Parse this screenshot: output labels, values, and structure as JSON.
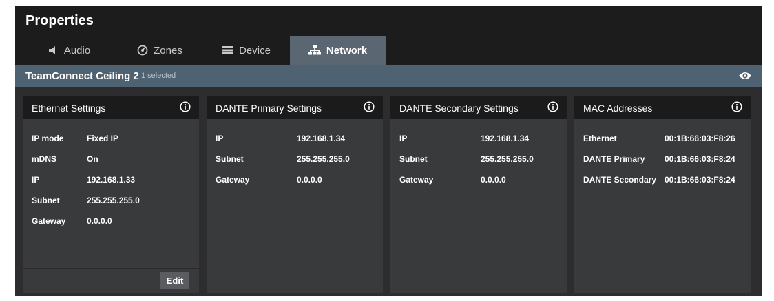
{
  "window": {
    "title": "Properties"
  },
  "tabs": [
    {
      "label": "Audio",
      "icon": "speaker-icon"
    },
    {
      "label": "Zones",
      "icon": "zones-icon"
    },
    {
      "label": "Device",
      "icon": "device-icon"
    },
    {
      "label": "Network",
      "icon": "network-icon",
      "active": true
    }
  ],
  "selection": {
    "device": "TeamConnect Ceiling 2",
    "count": "1 selected",
    "icon": "eye-icon"
  },
  "panels": {
    "ethernet": {
      "title": "Ethernet Settings",
      "rows": [
        {
          "label": "IP mode",
          "value": "Fixed IP"
        },
        {
          "label": "mDNS",
          "value": "On"
        },
        {
          "label": "IP",
          "value": "192.168.1.33"
        },
        {
          "label": "Subnet",
          "value": "255.255.255.0"
        },
        {
          "label": "Gateway",
          "value": "0.0.0.0"
        }
      ],
      "edit_label": "Edit"
    },
    "dante_primary": {
      "title": "DANTE Primary Settings",
      "rows": [
        {
          "label": "IP",
          "value": "192.168.1.34"
        },
        {
          "label": "Subnet",
          "value": "255.255.255.0"
        },
        {
          "label": "Gateway",
          "value": "0.0.0.0"
        }
      ]
    },
    "dante_secondary": {
      "title": "DANTE Secondary Settings",
      "rows": [
        {
          "label": "IP",
          "value": "192.168.1.34"
        },
        {
          "label": "Subnet",
          "value": "255.255.255.0"
        },
        {
          "label": "Gateway",
          "value": "0.0.0.0"
        }
      ]
    },
    "mac": {
      "title": "MAC Addresses",
      "rows": [
        {
          "label": "Ethernet",
          "value": "00:1B:66:03:F8:26"
        },
        {
          "label": "DANTE Primary",
          "value": "00:1B:66:03:F8:24"
        },
        {
          "label": "DANTE Secondary",
          "value": "00:1B:66:03:F8:24"
        }
      ]
    }
  },
  "colors": {
    "titlebar": "#1c1c1c",
    "panel": "#393a3c",
    "active_tab": "#5b6673",
    "selection_bar": "#4e6272"
  }
}
